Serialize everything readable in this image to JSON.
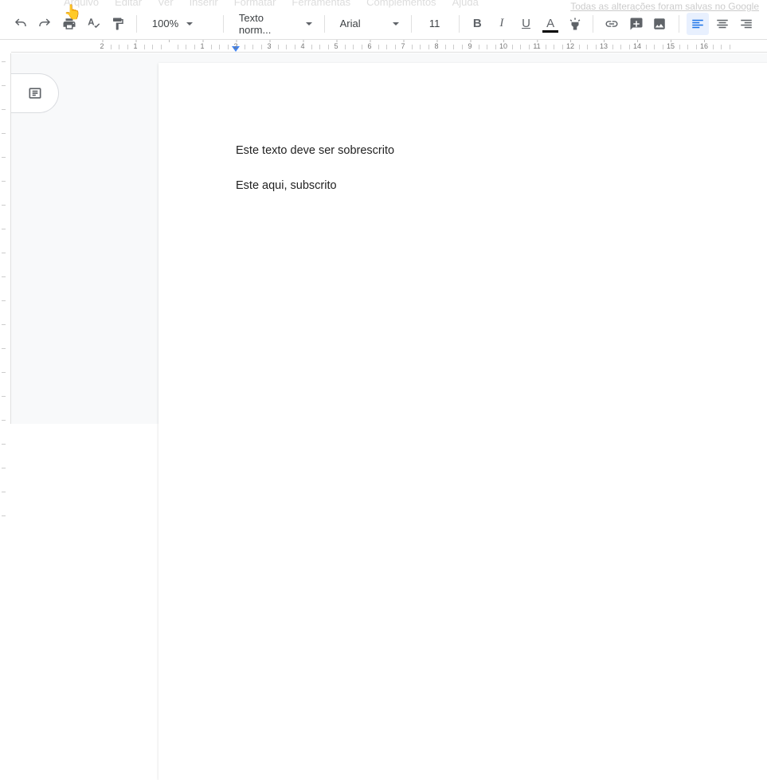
{
  "menubar": {
    "items": [
      "Arquivo",
      "Editar",
      "Ver",
      "Inserir",
      "Formatar",
      "Ferramentas",
      "Complementos",
      "Ajuda"
    ]
  },
  "status": {
    "text": "Todas as alterações foram salvas no Google"
  },
  "toolbar": {
    "zoom": "100%",
    "style": "Texto norm...",
    "font": "Arial",
    "size": "11"
  },
  "ruler": {
    "labels": [
      "2",
      "1",
      "",
      "1",
      "2",
      "3",
      "4",
      "5",
      "6",
      "7",
      "8",
      "9",
      "10",
      "11",
      "12",
      "13",
      "14",
      "15",
      "16"
    ]
  },
  "document": {
    "line1": "Este texto deve ser sobrescrito",
    "line2": "Este aqui, subscrito"
  }
}
